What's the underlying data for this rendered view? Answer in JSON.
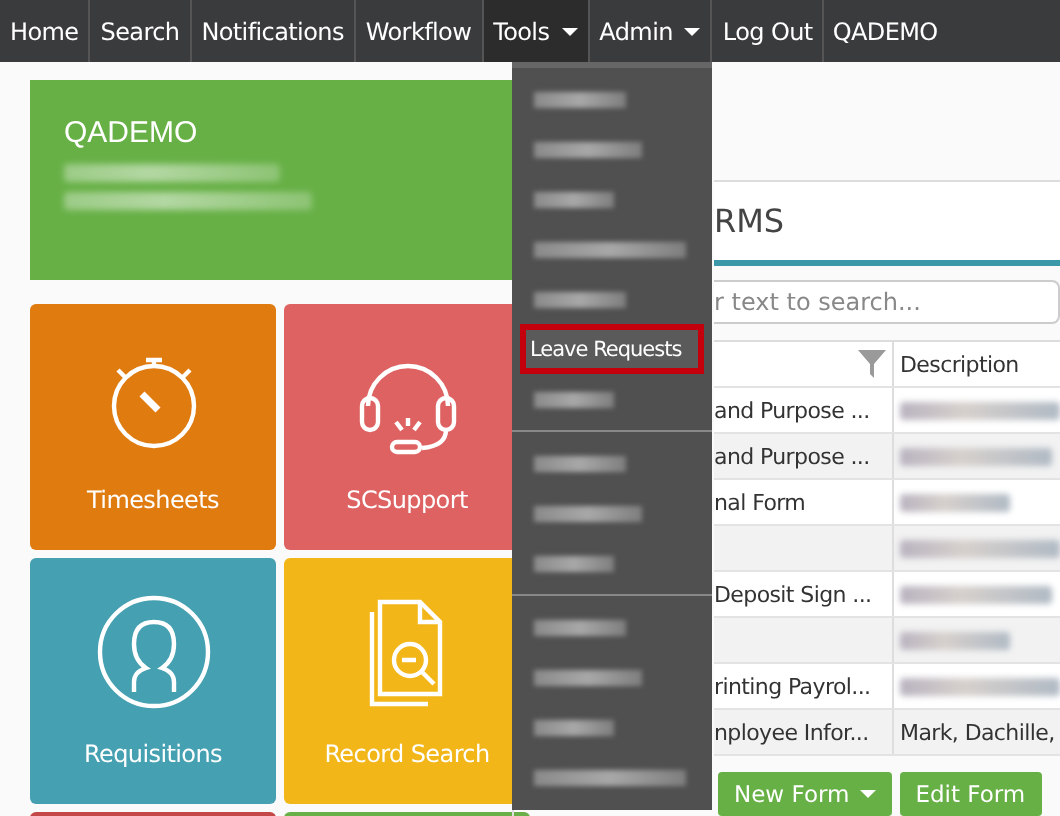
{
  "navbar": {
    "items": [
      {
        "label": "Home",
        "dropdown": false,
        "selected": false
      },
      {
        "label": "Search",
        "dropdown": false,
        "selected": false
      },
      {
        "label": "Notifications",
        "dropdown": false,
        "selected": false
      },
      {
        "label": "Workflow",
        "dropdown": false,
        "selected": false
      },
      {
        "label": "Tools",
        "dropdown": true,
        "selected": true
      },
      {
        "label": "Admin",
        "dropdown": true,
        "selected": false
      },
      {
        "label": "Log Out",
        "dropdown": false,
        "selected": false
      },
      {
        "label": "QADEMO",
        "dropdown": false,
        "selected": false
      }
    ]
  },
  "user_card": {
    "title": "QADEMO",
    "lines": [
      {
        "kind": "blurred"
      },
      {
        "kind": "blurred"
      }
    ]
  },
  "tiles": [
    {
      "label": "Timesheets",
      "color": "#e07b10"
    },
    {
      "label": "SCSupport",
      "color": "#de6262"
    },
    {
      "label": "Requisitions",
      "color": "#45a0b1"
    },
    {
      "label": "Record Search",
      "color": "#f2b619"
    },
    {
      "color": "#c44848"
    },
    {
      "color": "#68b047"
    }
  ],
  "tools_menu": {
    "items": [
      {
        "kind": "blurred",
        "selected": false
      },
      {
        "kind": "blurred",
        "selected": false
      },
      {
        "kind": "blurred",
        "selected": false
      },
      {
        "kind": "blurred",
        "selected": false
      },
      {
        "kind": "blurred",
        "selected": false
      },
      {
        "kind": "text",
        "label": "Leave Requests",
        "selected": true
      },
      {
        "kind": "blurred",
        "selected": false
      },
      {
        "kind": "divider"
      },
      {
        "kind": "blurred",
        "selected": false
      },
      {
        "kind": "blurred",
        "selected": false
      },
      {
        "kind": "blurred",
        "selected": false
      },
      {
        "kind": "divider"
      },
      {
        "kind": "blurred",
        "selected": false
      },
      {
        "kind": "blurred",
        "selected": false
      },
      {
        "kind": "blurred",
        "selected": false
      },
      {
        "kind": "blurred",
        "selected": false
      }
    ]
  },
  "forms_panel": {
    "title": "RMS",
    "search": {
      "placeholder": "r text to search..."
    },
    "columns": [
      {
        "filter": true
      },
      {
        "label": "Description",
        "filter": false
      }
    ],
    "rows": [
      {
        "name": "and Purpose ...",
        "description": {
          "kind": "blurred"
        }
      },
      {
        "name": "and Purpose ...",
        "description": {
          "kind": "blurred"
        }
      },
      {
        "name": "nal Form",
        "description": {
          "kind": "blurred"
        }
      },
      {
        "description": {
          "kind": "blurred"
        }
      },
      {
        "name": "Deposit Sign ...",
        "description": {
          "kind": "blurred"
        }
      },
      {
        "description": {
          "kind": "blurred"
        }
      },
      {
        "name": "rinting Payrol...",
        "description": {
          "kind": "blurred"
        }
      },
      {
        "name": "nployee Infor...",
        "description": {
          "kind": "text",
          "text": "Mark, Dachille,"
        }
      }
    ],
    "buttons": [
      {
        "label": "New Form",
        "dropdown": true
      },
      {
        "label": "Edit Form",
        "dropdown": false
      }
    ]
  }
}
